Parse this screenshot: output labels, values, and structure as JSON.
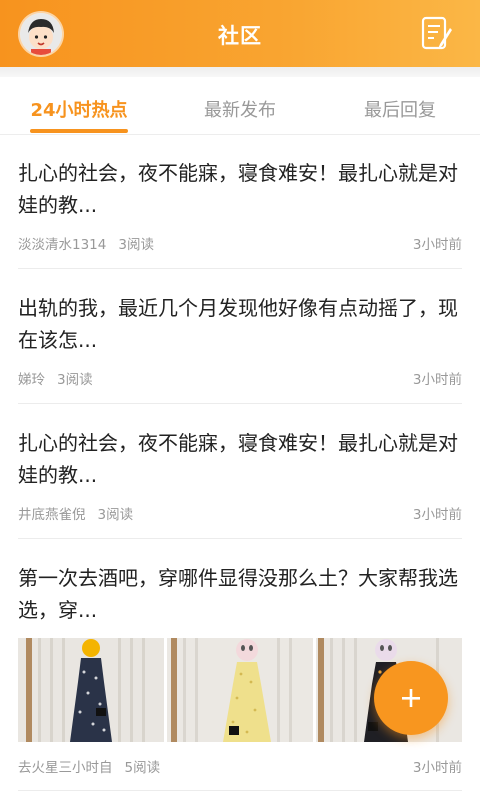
{
  "header": {
    "title": "社区",
    "accent_color": "#f7931e",
    "avatar_icon": "user-avatar",
    "compose_icon": "edit-note-icon"
  },
  "tabs": [
    {
      "label": "24小时热点",
      "active": true
    },
    {
      "label": "最新发布",
      "active": false
    },
    {
      "label": "最后回复",
      "active": false
    }
  ],
  "posts": [
    {
      "title": "扎心的社会，夜不能寐，寝食难安！最扎心就是对娃的教...",
      "author": "淡淡清水1314",
      "reads": "3阅读",
      "time": "3小时前"
    },
    {
      "title": "出轨的我，最近几个月发现他好像有点动摇了，现在该怎...",
      "author": "娣玲",
      "reads": "3阅读",
      "time": "3小时前"
    },
    {
      "title": "扎心的社会，夜不能寐，寝食难安！最扎心就是对娃的教...",
      "author": "井底燕雀倪",
      "reads": "3阅读",
      "time": "3小时前"
    },
    {
      "title": "第一次去酒吧，穿哪件显得没那么土？大家帮我选选，穿...",
      "author": "去火星三小时自",
      "reads": "5阅读",
      "time": "3小时前",
      "images": [
        "dress-photo-1",
        "dress-photo-2",
        "dress-photo-3"
      ]
    }
  ],
  "fab": {
    "icon": "plus-icon"
  }
}
